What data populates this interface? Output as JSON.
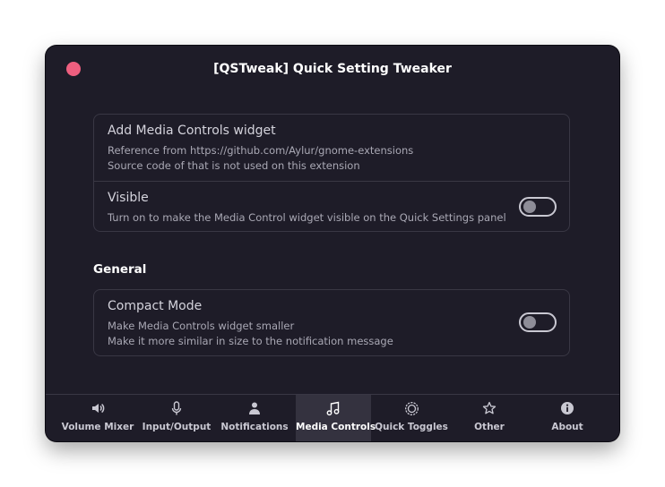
{
  "window": {
    "title": "[QSTweak] Quick Setting Tweaker"
  },
  "media_widget_card": {
    "add_row": {
      "title": "Add Media Controls widget",
      "line1": "Reference from https://github.com/Aylur/gnome-extensions",
      "line2": "Source code of that is not used on this extension"
    },
    "visible_row": {
      "title": "Visible",
      "subtitle": "Turn on to make the Media Control widget visible on the Quick Settings panel",
      "toggle_on": false
    }
  },
  "general_section": {
    "heading": "General",
    "compact_row": {
      "title": "Compact Mode",
      "line1": "Make Media Controls widget smaller",
      "line2": "Make it more similar in size to the notification message",
      "toggle_on": false
    }
  },
  "nav": {
    "active": "Media Controls",
    "tabs": [
      {
        "label": "Volume Mixer",
        "icon": "speaker-icon"
      },
      {
        "label": "Input/Output",
        "icon": "microphone-icon"
      },
      {
        "label": "Notifications",
        "icon": "person-icon"
      },
      {
        "label": "Media Controls",
        "icon": "music-note-icon"
      },
      {
        "label": "Quick Toggles",
        "icon": "toggles-icon"
      },
      {
        "label": "Other",
        "icon": "star-icon"
      },
      {
        "label": "About",
        "icon": "info-icon"
      }
    ]
  },
  "colors": {
    "window_bg": "#1e1c28",
    "close_button": "#ee5f7f",
    "active_tab_bg": "#34323f",
    "border": "#393744"
  }
}
